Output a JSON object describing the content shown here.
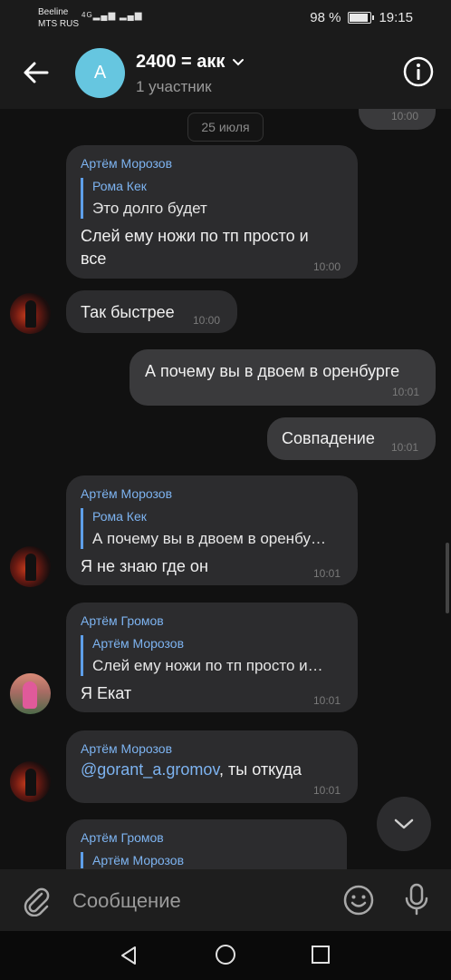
{
  "status": {
    "carrier_1": "Beeline",
    "carrier_2": "MTS RUS",
    "network": "4G",
    "battery": "98 %",
    "time": "19:15"
  },
  "header": {
    "avatar_letter": "A",
    "title": "2400 = акк",
    "subtitle": "1 участник"
  },
  "chat": {
    "top_partial_time": "10:00",
    "top_partial_text": "?",
    "date": "25 июля",
    "messages": [
      {
        "sender": "Артём Морозов",
        "reply_name": "Рома Кек",
        "reply_text": "Это долго будет",
        "line1": "Слей ему ножи по тп просто и",
        "line2": "все",
        "time": "10:00"
      },
      {
        "text": "Так быстрее",
        "time": "10:00"
      },
      {
        "text": "А почему вы в двоем в оренбурге",
        "time": "10:01"
      },
      {
        "text": "Совпадение",
        "time": "10:01"
      },
      {
        "sender": "Артём Морозов",
        "reply_name": "Рома Кек",
        "reply_text": "А почему вы в двоем в оренбу…",
        "text": "Я не знаю где он",
        "time": "10:01"
      },
      {
        "sender": "Артём Громов",
        "reply_name": "Артём Морозов",
        "reply_text": "Слей ему ножи по тп просто и…",
        "text": "Я Екат",
        "time": "10:01"
      },
      {
        "sender": "Артём Морозов",
        "mention": "@gorant_a.gromov",
        "text": ", ты откуда",
        "time": "10:01"
      },
      {
        "sender": "Артём Громов",
        "reply_name": "Артём Морозов"
      }
    ]
  },
  "composer": {
    "placeholder": "Сообщение"
  },
  "icons": {
    "back": "arrow-left-icon",
    "info": "info-icon",
    "attach": "paperclip-icon",
    "emoji": "smile-icon",
    "mic": "microphone-icon",
    "scroll_down": "chevron-down-icon"
  },
  "colors": {
    "accent": "#7db3f0",
    "group_avatar": "#66c6e0",
    "bubble_in": "#2c2c2e",
    "bubble_out": "#3a3a3c"
  }
}
